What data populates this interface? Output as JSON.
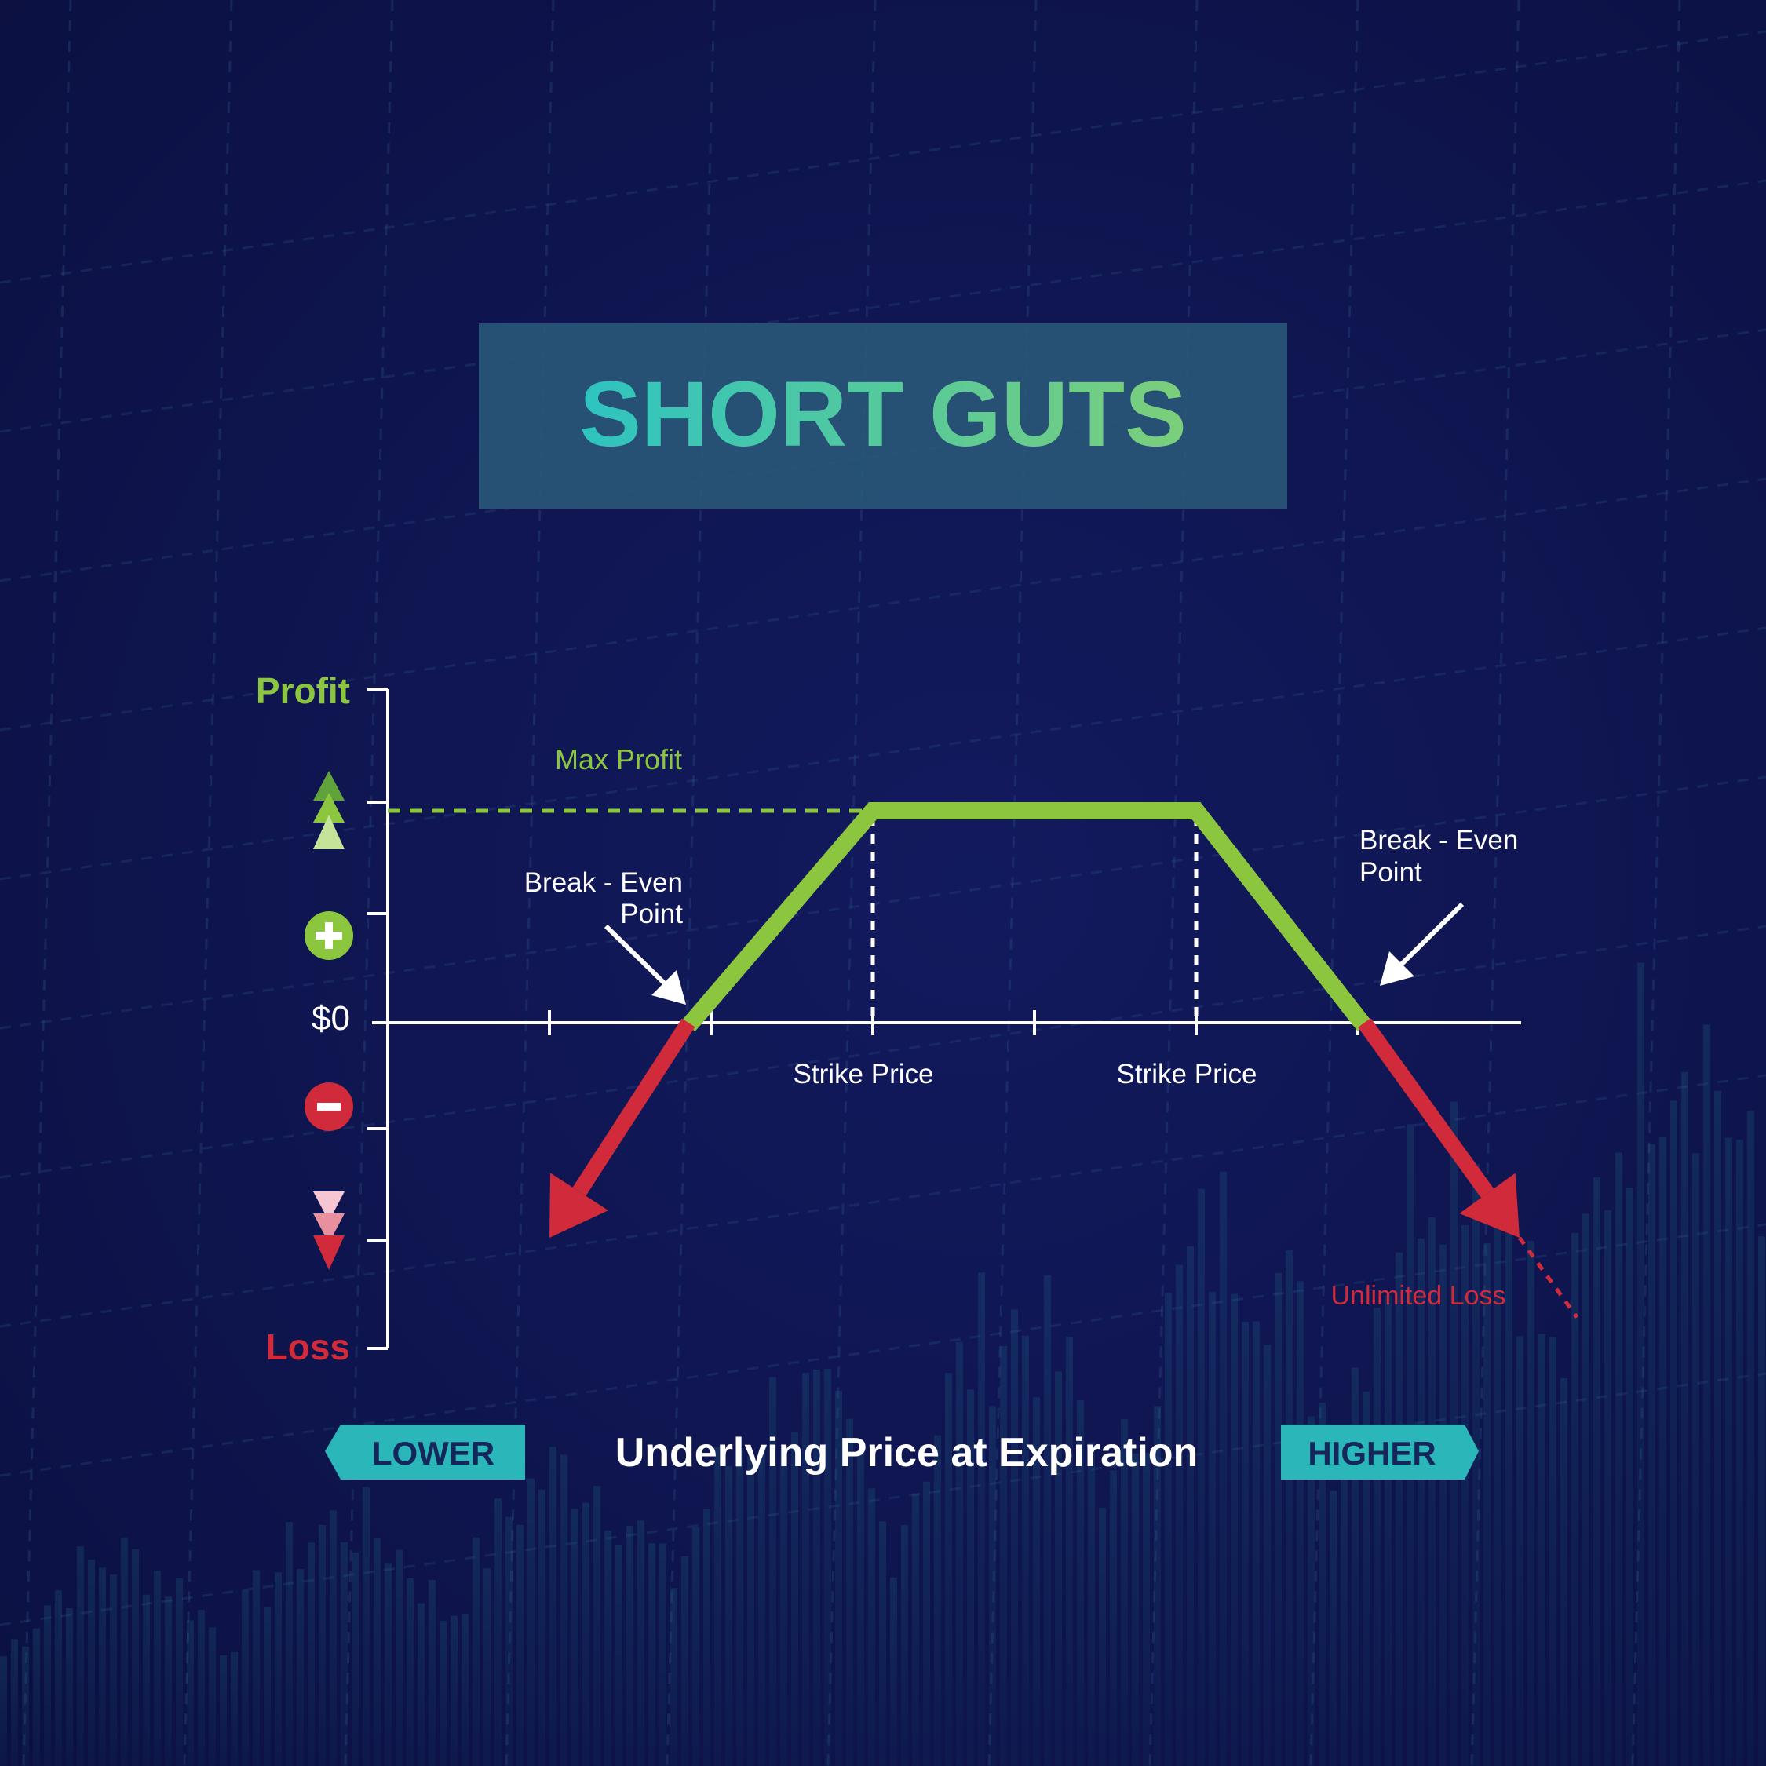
{
  "title": "SHORT GUTS",
  "colors": {
    "background": "#0f1552",
    "title_box": "#2a5a7a",
    "title_text_start": "#2ec4c0",
    "title_text_end": "#7ccf7a",
    "profit": "#8cc63f",
    "loss": "#d12a3a",
    "axis": "#ffffff",
    "badge": "#2bb7b9",
    "badge_text": "#14265a"
  },
  "chart_data": {
    "type": "line",
    "title": "SHORT GUTS",
    "xlabel": "Underlying Price at Expiration",
    "ylabel": "",
    "y_axis": {
      "top_label": "Profit",
      "bottom_label": "Loss",
      "zero_label": "$0"
    },
    "x_ticks": [
      "",
      "",
      "Strike Price",
      "",
      "Strike Price",
      ""
    ],
    "strike_label": "Strike Price",
    "max_profit_label": "Max Profit",
    "break_even_label_line1": "Break - Even",
    "break_even_label_line2": "Point",
    "unlimited_loss_label": "Unlimited Loss",
    "series": [
      {
        "segment": "profit",
        "x": [
          1.86,
          3.0,
          5.0,
          6.04
        ],
        "y": [
          0,
          1,
          1,
          0
        ]
      },
      {
        "segment": "loss-left",
        "x": [
          1.86,
          1.0
        ],
        "y": [
          0,
          -1.0
        ]
      },
      {
        "segment": "loss-right",
        "x": [
          6.04,
          7.0
        ],
        "y": [
          0,
          -1.0
        ]
      }
    ],
    "grid": false
  },
  "footer": {
    "lower_label": "LOWER",
    "higher_label": "HIGHER",
    "axis_title": "Underlying Price at Expiration"
  },
  "icons": [
    "up-arrows-icon",
    "plus-circle-icon",
    "minus-circle-icon",
    "down-arrows-icon",
    "break-even-arrow-icon"
  ]
}
